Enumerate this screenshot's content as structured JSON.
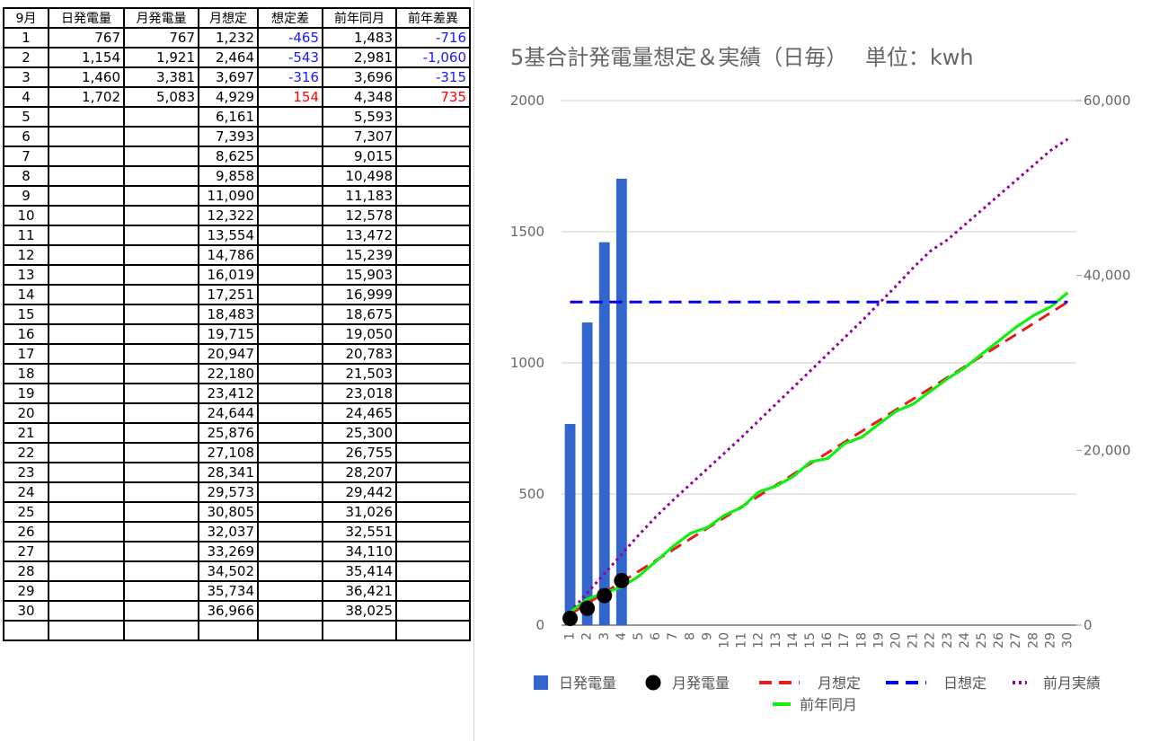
{
  "sheet": {
    "headers": [
      "9月",
      "日発電量",
      "月発電量",
      "月想定",
      "想定差",
      "前年同月",
      "前年差異"
    ],
    "rows": [
      [
        "1",
        "767",
        "767",
        "1,232",
        "-465",
        "1,483",
        "-716"
      ],
      [
        "2",
        "1,154",
        "1,921",
        "2,464",
        "-543",
        "2,981",
        "-1,060"
      ],
      [
        "3",
        "1,460",
        "3,381",
        "3,697",
        "-316",
        "3,696",
        "-315"
      ],
      [
        "4",
        "1,702",
        "5,083",
        "4,929",
        "154",
        "4,348",
        "735"
      ],
      [
        "5",
        "",
        "",
        "6,161",
        "",
        "5,593",
        ""
      ],
      [
        "6",
        "",
        "",
        "7,393",
        "",
        "7,307",
        ""
      ],
      [
        "7",
        "",
        "",
        "8,625",
        "",
        "9,015",
        ""
      ],
      [
        "8",
        "",
        "",
        "9,858",
        "",
        "10,498",
        ""
      ],
      [
        "9",
        "",
        "",
        "11,090",
        "",
        "11,183",
        ""
      ],
      [
        "10",
        "",
        "",
        "12,322",
        "",
        "12,578",
        ""
      ],
      [
        "11",
        "",
        "",
        "13,554",
        "",
        "13,472",
        ""
      ],
      [
        "12",
        "",
        "",
        "14,786",
        "",
        "15,239",
        ""
      ],
      [
        "13",
        "",
        "",
        "16,019",
        "",
        "15,903",
        ""
      ],
      [
        "14",
        "",
        "",
        "17,251",
        "",
        "16,999",
        ""
      ],
      [
        "15",
        "",
        "",
        "18,483",
        "",
        "18,675",
        ""
      ],
      [
        "16",
        "",
        "",
        "19,715",
        "",
        "19,050",
        ""
      ],
      [
        "17",
        "",
        "",
        "20,947",
        "",
        "20,783",
        ""
      ],
      [
        "18",
        "",
        "",
        "22,180",
        "",
        "21,503",
        ""
      ],
      [
        "19",
        "",
        "",
        "23,412",
        "",
        "23,018",
        ""
      ],
      [
        "20",
        "",
        "",
        "24,644",
        "",
        "24,465",
        ""
      ],
      [
        "21",
        "",
        "",
        "25,876",
        "",
        "25,300",
        ""
      ],
      [
        "22",
        "",
        "",
        "27,108",
        "",
        "26,755",
        ""
      ],
      [
        "23",
        "",
        "",
        "28,341",
        "",
        "28,207",
        ""
      ],
      [
        "24",
        "",
        "",
        "29,573",
        "",
        "29,442",
        ""
      ],
      [
        "25",
        "",
        "",
        "30,805",
        "",
        "31,026",
        ""
      ],
      [
        "26",
        "",
        "",
        "32,037",
        "",
        "32,551",
        ""
      ],
      [
        "27",
        "",
        "",
        "33,269",
        "",
        "34,110",
        ""
      ],
      [
        "28",
        "",
        "",
        "34,502",
        "",
        "35,414",
        ""
      ],
      [
        "29",
        "",
        "",
        "35,734",
        "",
        "36,421",
        ""
      ],
      [
        "30",
        "",
        "",
        "36,966",
        "",
        "38,025",
        ""
      ]
    ]
  },
  "colors": {
    "negative": "#1a1aff",
    "positive": "#ff0000",
    "bars": "#3366cc",
    "monthly_gen": "#000000",
    "monthly_target": "#e02020",
    "daily_target": "#0000ee",
    "prev_month": "#990099",
    "prev_year": "#11ee11",
    "axis_text": "#666666",
    "grid": "#cccccc"
  },
  "chart_data": {
    "type": "bar",
    "title": "5基合計発電量想定＆実績（日毎）　 単位：kwh",
    "categories": [
      "1",
      "2",
      "3",
      "4",
      "5",
      "6",
      "7",
      "8",
      "9",
      "10",
      "11",
      "12",
      "13",
      "14",
      "15",
      "16",
      "17",
      "18",
      "19",
      "20",
      "21",
      "22",
      "23",
      "24",
      "25",
      "26",
      "27",
      "28",
      "29",
      "30"
    ],
    "left_axis": {
      "min": 0,
      "max": 2000,
      "ticks": [
        "0",
        "500",
        "1000",
        "1500",
        "2000"
      ]
    },
    "right_axis": {
      "min": 0,
      "max": 60000,
      "ticks": [
        "0",
        "20,000",
        "40,000",
        "60,000"
      ]
    },
    "grid": true,
    "legend_position": "bottom",
    "series": [
      {
        "name": "日発電量",
        "kind": "bar",
        "axis": "left",
        "values": [
          767,
          1154,
          1460,
          1702
        ]
      },
      {
        "name": "月発電量",
        "kind": "points",
        "axis": "right",
        "values": [
          767,
          1921,
          3381,
          5083
        ]
      },
      {
        "name": "月想定",
        "kind": "line-dashed",
        "axis": "right",
        "values": [
          1232,
          2464,
          3697,
          4929,
          6161,
          7393,
          8625,
          9858,
          11090,
          12322,
          13554,
          14786,
          16019,
          17251,
          18483,
          19715,
          20947,
          22180,
          23412,
          24644,
          25876,
          27108,
          28341,
          29573,
          30805,
          32037,
          33269,
          34502,
          35734,
          36966
        ]
      },
      {
        "name": "日想定",
        "kind": "line-dashed",
        "axis": "left",
        "values": [
          1232,
          1232,
          1232,
          1232,
          1232,
          1232,
          1232,
          1232,
          1232,
          1232,
          1232,
          1232,
          1232,
          1232,
          1232,
          1232,
          1232,
          1232,
          1232,
          1232,
          1232,
          1232,
          1232,
          1232,
          1232,
          1232,
          1232,
          1232,
          1232,
          1232
        ]
      },
      {
        "name": "前月実績",
        "kind": "line-dotted",
        "axis": "right",
        "values": [
          1500,
          3700,
          5900,
          8100,
          10300,
          12400,
          14300,
          16100,
          17900,
          19700,
          21500,
          23400,
          25300,
          27200,
          29100,
          31000,
          32900,
          34800,
          36800,
          38800,
          40900,
          42800,
          44100,
          45800,
          47500,
          49200,
          50900,
          52600,
          54300,
          55600
        ]
      },
      {
        "name": "前年同月",
        "kind": "line",
        "axis": "right",
        "values": [
          1483,
          2981,
          3696,
          4348,
          5593,
          7307,
          9015,
          10498,
          11183,
          12578,
          13472,
          15239,
          15903,
          16999,
          18675,
          19050,
          20783,
          21503,
          23018,
          24465,
          25300,
          26755,
          28207,
          29442,
          31026,
          32551,
          34110,
          35414,
          36421,
          38025
        ]
      }
    ]
  }
}
